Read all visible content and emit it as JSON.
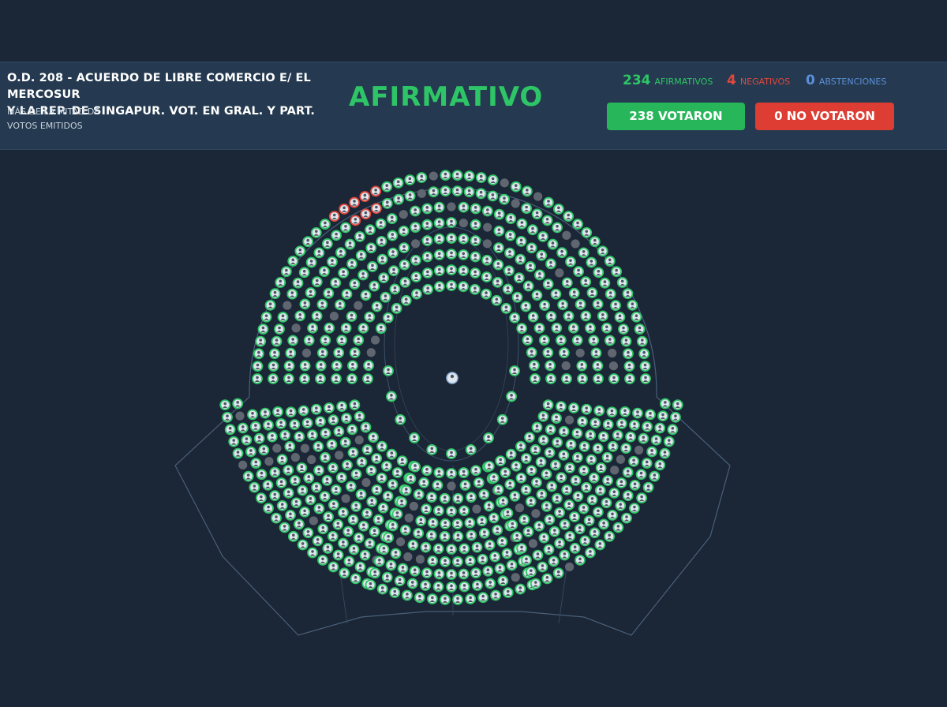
{
  "session": {
    "title_line1": "O.D. 208 - ACUERDO DE LIBRE COMERCIO E/ EL MERCOSUR",
    "title_line2": "Y LA REP. DE SINGAPUR. VOT. EN GRAL. Y PART.",
    "majority_line1": "MÁS DE LA MITAD DE",
    "majority_line2": "VOTOS EMITIDOS"
  },
  "result": {
    "label": "AFIRMATIVO",
    "color": "#2ec566"
  },
  "tallies": {
    "affirmative": {
      "count": "234",
      "label": "AFIRMATIVOS",
      "color": "#2ec566"
    },
    "negative": {
      "count": "4",
      "label": "NEGATIVOS",
      "color": "#e0473d"
    },
    "abstention": {
      "count": "0",
      "label": "ABSTENCIONES",
      "color": "#5b8fd8"
    }
  },
  "buttons": {
    "voted": {
      "label": "238 VOTARON",
      "color": "#27b75a"
    },
    "not_voted": {
      "label": "0 NO VOTARON",
      "color": "#dd3d33"
    }
  },
  "chamber": {
    "seat_states": [
      "affirmative",
      "negative",
      "empty",
      "president"
    ],
    "seat_colors": {
      "affirmative": "#2ec566",
      "negative": "#e0473d",
      "empty": "#5f6670",
      "president": "#8fb2d8"
    },
    "outline_color": "#4a6078"
  }
}
